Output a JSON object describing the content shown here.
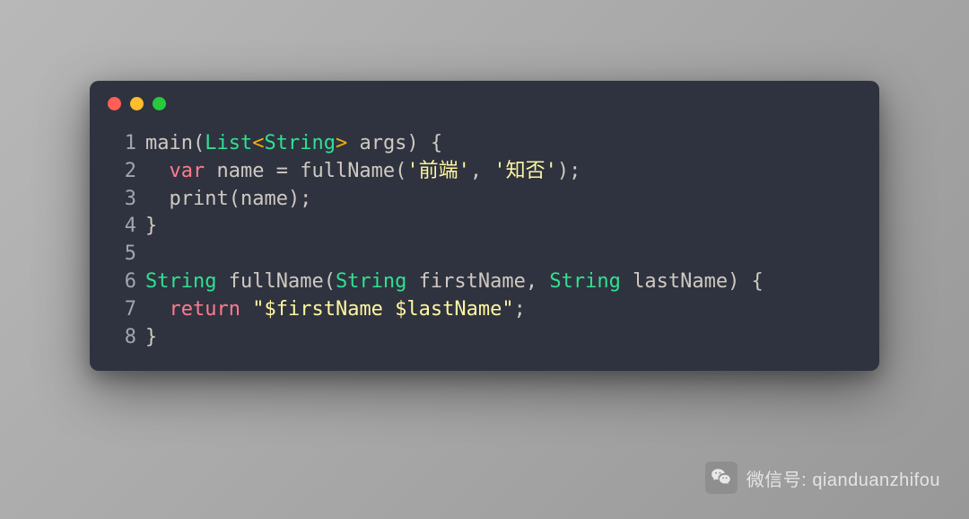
{
  "code": {
    "lines": [
      {
        "n": "1",
        "tokens": [
          {
            "t": "main(",
            "c": "pn"
          },
          {
            "t": "List",
            "c": "ty"
          },
          {
            "t": "<",
            "c": "an"
          },
          {
            "t": "String",
            "c": "ty"
          },
          {
            "t": ">",
            "c": "an"
          },
          {
            "t": " args) {",
            "c": "pn"
          }
        ]
      },
      {
        "n": "2",
        "tokens": [
          {
            "t": "  ",
            "c": "pn"
          },
          {
            "t": "var",
            "c": "kw"
          },
          {
            "t": " name = fullName(",
            "c": "pn"
          },
          {
            "t": "'前端'",
            "c": "st"
          },
          {
            "t": ", ",
            "c": "pn"
          },
          {
            "t": "'知否'",
            "c": "st"
          },
          {
            "t": ");",
            "c": "pn"
          }
        ]
      },
      {
        "n": "3",
        "tokens": [
          {
            "t": "  print(name);",
            "c": "pn"
          }
        ]
      },
      {
        "n": "4",
        "tokens": [
          {
            "t": "}",
            "c": "pn"
          }
        ]
      },
      {
        "n": "5",
        "tokens": []
      },
      {
        "n": "6",
        "tokens": [
          {
            "t": "String",
            "c": "ty"
          },
          {
            "t": " fullName(",
            "c": "pn"
          },
          {
            "t": "String",
            "c": "ty"
          },
          {
            "t": " firstName, ",
            "c": "pn"
          },
          {
            "t": "String",
            "c": "ty"
          },
          {
            "t": " lastName) {",
            "c": "pn"
          }
        ]
      },
      {
        "n": "7",
        "tokens": [
          {
            "t": "  ",
            "c": "pn"
          },
          {
            "t": "return",
            "c": "kw"
          },
          {
            "t": " ",
            "c": "pn"
          },
          {
            "t": "\"$firstName $lastName\"",
            "c": "st"
          },
          {
            "t": ";",
            "c": "pn"
          }
        ]
      },
      {
        "n": "8",
        "tokens": [
          {
            "t": "}",
            "c": "pn"
          }
        ]
      }
    ]
  },
  "footer": {
    "label": "微信号:",
    "value": "qianduanzhifou"
  }
}
